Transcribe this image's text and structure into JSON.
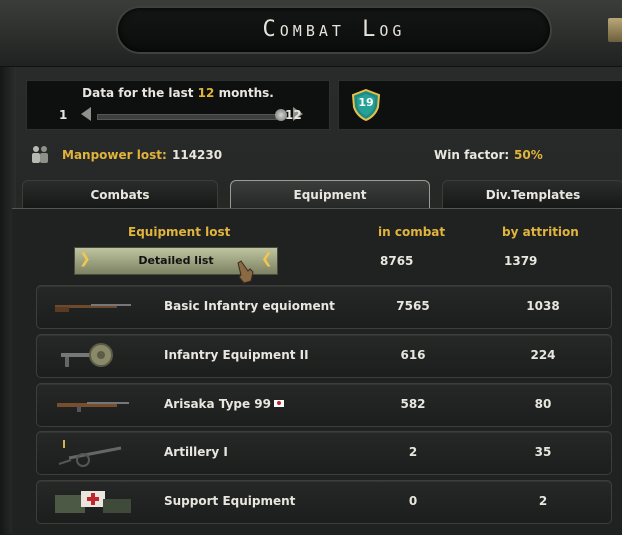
{
  "window": {
    "title": "Combat Log"
  },
  "range": {
    "prefix": "Data for the last",
    "months": "12",
    "suffix": "months.",
    "min": "1",
    "max": "12",
    "slider_fraction": 1.0
  },
  "badge": {
    "value": "19"
  },
  "stats": {
    "manpower_label": "Manpower lost:",
    "manpower_value": "114230",
    "win_label": "Win factor:",
    "win_value": "50%"
  },
  "tabs": [
    {
      "label": "Combats",
      "active": false
    },
    {
      "label": "Equipment",
      "active": true
    },
    {
      "label": "Div.Templates",
      "active": false
    }
  ],
  "table": {
    "headers": {
      "name": "Equipment lost",
      "combat": "in combat",
      "attrition": "by attrition"
    },
    "detail_button": "Detailed list",
    "totals": {
      "combat": "8765",
      "attrition": "1379"
    },
    "rows": [
      {
        "name": "Basic Infantry equioment",
        "icon": "rifle-icon",
        "combat": "7565",
        "attrition": "1038"
      },
      {
        "name": "Infantry Equipment II",
        "icon": "machine-gun-icon",
        "combat": "616",
        "attrition": "224"
      },
      {
        "name": "Arisaka Type 99",
        "icon": "rifle-icon",
        "combat": "582",
        "attrition": "80",
        "flag": "japan-flag-icon"
      },
      {
        "name": "Artillery I",
        "icon": "artillery-icon",
        "combat": "2",
        "attrition": "35"
      },
      {
        "name": "Support Equipment",
        "icon": "support-equipment-icon",
        "combat": "0",
        "attrition": "2"
      }
    ]
  },
  "colors": {
    "accent_gold": "#e1b43c",
    "text": "#e8e6df",
    "panel": "#202221"
  }
}
